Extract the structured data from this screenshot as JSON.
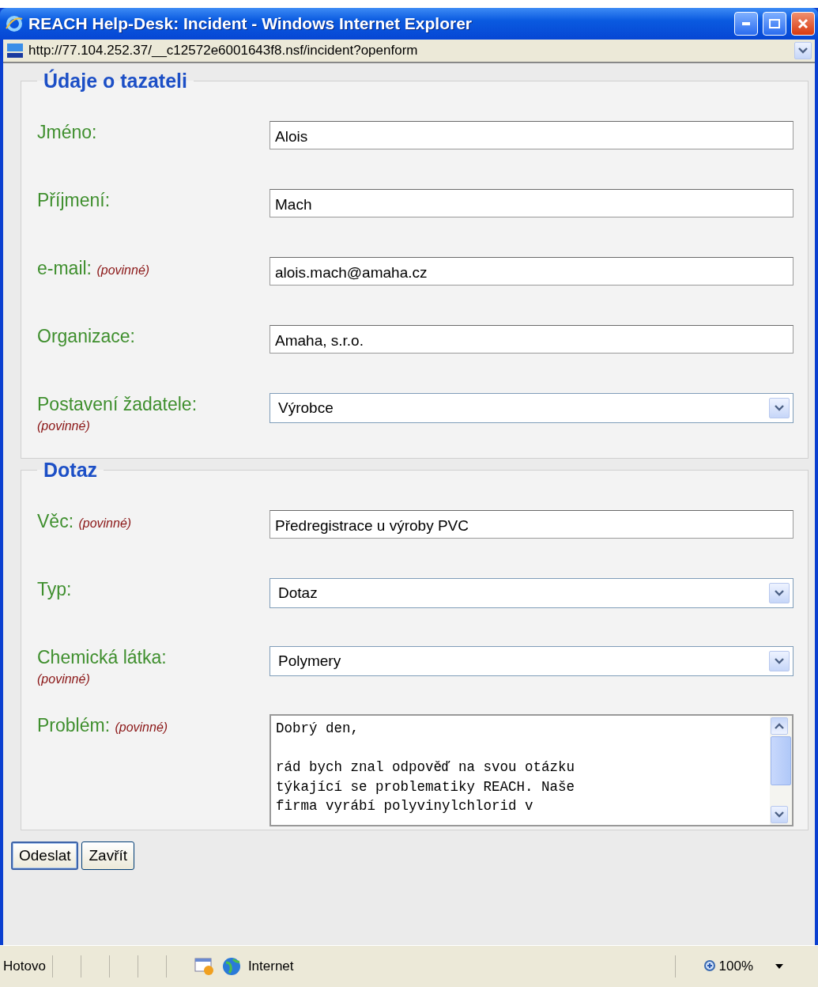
{
  "window": {
    "title": "REACH Help-Desk: Incident - Windows Internet Explorer"
  },
  "address_bar": {
    "url": "http://77.104.252.37/__c12572e6001643f8.nsf/incident?openform"
  },
  "sections": [
    {
      "legend": "Údaje o tazateli",
      "fields": [
        {
          "kind": "text",
          "label": "Jméno:",
          "value": "Alois"
        },
        {
          "kind": "text",
          "label": "Příjmení:",
          "value": "Mach"
        },
        {
          "kind": "text",
          "label": "e-mail:",
          "note": "(povinné)",
          "value": "alois.mach@amaha.cz"
        },
        {
          "kind": "text",
          "label": "Organizace:",
          "value": "Amaha, s.r.o."
        },
        {
          "kind": "select",
          "label": "Postavení žadatele:",
          "note": "(povinné)",
          "value": "Výrobce"
        }
      ]
    },
    {
      "legend": "Dotaz",
      "fields": [
        {
          "kind": "text",
          "label": "Věc:",
          "note": "(povinné)",
          "value": "Předregistrace u výroby PVC"
        },
        {
          "kind": "select",
          "label": "Typ:",
          "value": "Dotaz"
        },
        {
          "kind": "select",
          "label": "Chemická látka:",
          "note": "(povinné)",
          "value": "Polymery"
        },
        {
          "kind": "textarea",
          "label": "Problém:",
          "note": "(povinné)",
          "text": "Dobrý den,\n\nrád bych znal odpověď na svou otázku\ntýkající se problematiky REACH. Naše\nfirma vyrábí polyvinylchlorid v"
        }
      ]
    }
  ],
  "buttons": [
    {
      "label": "Odeslat",
      "selected": true
    },
    {
      "label": "Zavřít",
      "selected": false
    }
  ],
  "status_bar": {
    "status": "Hotovo",
    "zone": "Internet",
    "zoom": "100%"
  }
}
